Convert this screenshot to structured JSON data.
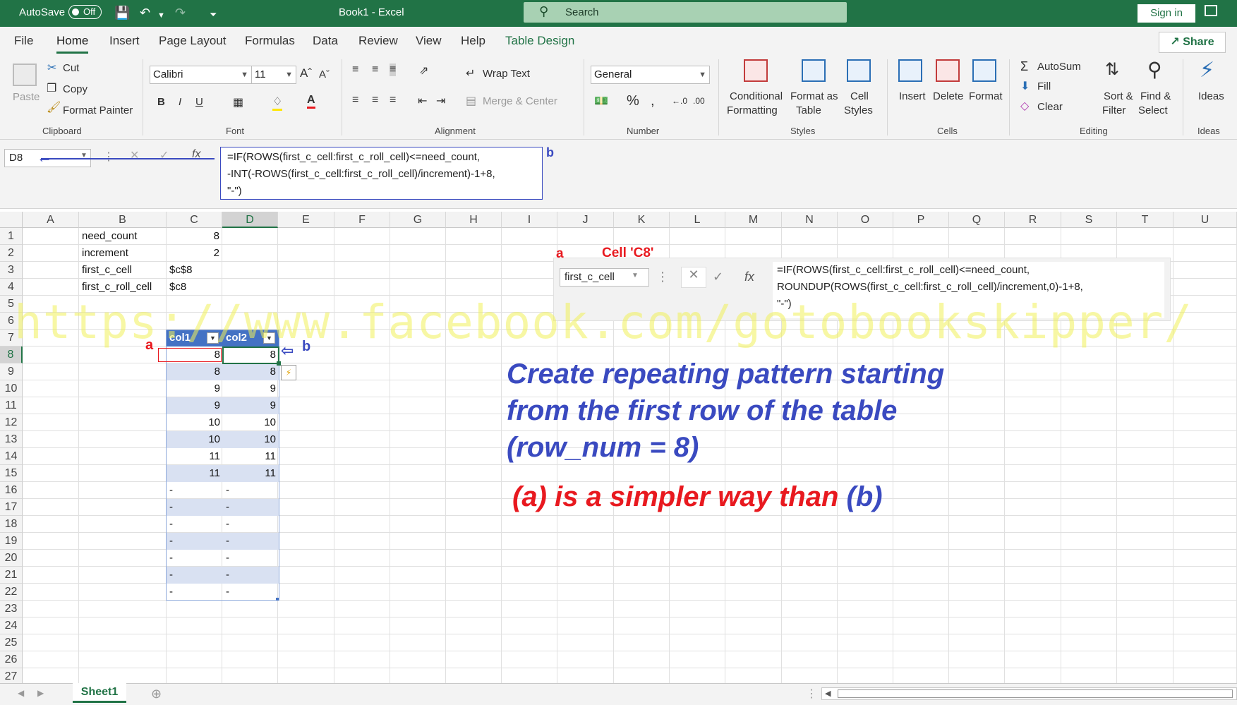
{
  "titlebar": {
    "autosave_label": "AutoSave",
    "autosave_state": "Off",
    "title": "Book1 - Excel",
    "search_placeholder": "Search",
    "signin": "Sign in"
  },
  "tabs": [
    "File",
    "Home",
    "Insert",
    "Page Layout",
    "Formulas",
    "Data",
    "Review",
    "View",
    "Help",
    "Table Design"
  ],
  "share": "Share",
  "ribbon": {
    "clipboard": {
      "paste": "Paste",
      "cut": "Cut",
      "copy": "Copy",
      "format_painter": "Format Painter",
      "label": "Clipboard"
    },
    "font": {
      "name": "Calibri",
      "size": "11",
      "label": "Font",
      "bold": "B",
      "italic": "I",
      "underline": "U"
    },
    "alignment": {
      "wrap": "Wrap Text",
      "merge": "Merge & Center",
      "label": "Alignment"
    },
    "number": {
      "format": "General",
      "label": "Number",
      "percent": "%"
    },
    "styles": {
      "conditional_1": "Conditional",
      "conditional_2": "Formatting",
      "format_table_1": "Format as",
      "format_table_2": "Table",
      "cell_styles_1": "Cell",
      "cell_styles_2": "Styles",
      "label": "Styles"
    },
    "cells": {
      "insert": "Insert",
      "delete": "Delete",
      "format": "Format",
      "label": "Cells"
    },
    "editing": {
      "autosum": "AutoSum",
      "fill": "Fill",
      "clear": "Clear",
      "sort_1": "Sort &",
      "sort_2": "Filter",
      "find_1": "Find &",
      "find_2": "Select",
      "label": "Editing"
    },
    "ideas": {
      "btn": "Ideas",
      "label": "Ideas"
    }
  },
  "formula_bar": {
    "namebox": "D8",
    "formula": "=IF(ROWS(first_c_cell:first_c_roll_cell)<=need_count,\n-INT(-ROWS(first_c_cell:first_c_roll_cell)/increment)-1+8,\n\"-\")"
  },
  "columns": [
    "A",
    "B",
    "C",
    "D",
    "E",
    "F",
    "G",
    "H",
    "I",
    "J",
    "K",
    "L",
    "M",
    "N",
    "O",
    "P",
    "Q",
    "R",
    "S",
    "T",
    "U"
  ],
  "rows": [
    "1",
    "2",
    "3",
    "4",
    "5",
    "6",
    "7",
    "8",
    "9",
    "10",
    "11",
    "12",
    "13",
    "14",
    "15",
    "16",
    "17",
    "18",
    "19",
    "20",
    "21",
    "22",
    "23",
    "24",
    "25",
    "26",
    "27"
  ],
  "named_ranges": [
    {
      "name": "need_count",
      "value": "8"
    },
    {
      "name": "increment",
      "value": "2"
    },
    {
      "name": "first_c_cell",
      "value": "$c$8"
    },
    {
      "name": "first_c_roll_cell",
      "value": "$c8"
    }
  ],
  "table": {
    "headers": [
      "col1",
      "col2"
    ],
    "rows": [
      [
        "8",
        "8"
      ],
      [
        "8",
        "8"
      ],
      [
        "9",
        "9"
      ],
      [
        "9",
        "9"
      ],
      [
        "10",
        "10"
      ],
      [
        "10",
        "10"
      ],
      [
        "11",
        "11"
      ],
      [
        "11",
        "11"
      ],
      [
        "-",
        "-"
      ],
      [
        "-",
        "-"
      ],
      [
        "-",
        "-"
      ],
      [
        "-",
        "-"
      ],
      [
        "-",
        "-"
      ],
      [
        "-",
        "-"
      ],
      [
        "-",
        "-"
      ]
    ]
  },
  "callout": {
    "label_a": "a",
    "title": "Cell 'C8'",
    "namebox": "first_c_cell",
    "formula": "=IF(ROWS(first_c_cell:first_c_roll_cell)<=need_count,\nROUNDUP(ROWS(first_c_cell:first_c_roll_cell)/increment,0)-1+8,\n\"-\")"
  },
  "annotations": {
    "a": "a",
    "b": "b",
    "watermark": "https://www.facebook.com/gotobookskipper/",
    "line1": "Create repeating pattern starting",
    "line2": "from the first row of the table",
    "line3": "(row_num = 8)",
    "line4_a": "(a) is a simpler way than ",
    "line4_b": "(b)"
  },
  "sheet": {
    "tab": "Sheet1"
  },
  "colors": {
    "excel_green": "#217346",
    "table_header": "#4472c4",
    "band": "#d9e1f2",
    "annotation_blue": "#3a4ac0",
    "annotation_red": "#e8191f"
  }
}
